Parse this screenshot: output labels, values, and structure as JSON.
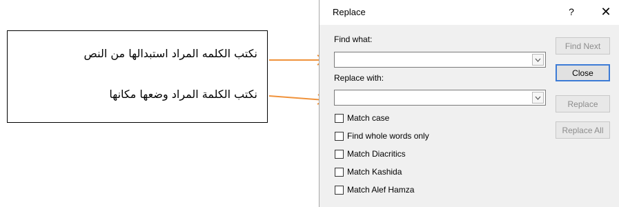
{
  "annotations": {
    "note1": "نكتب الكلمه المراد استبدالها من النص",
    "note2": "نكتب الكلمة المراد وضعها مكانها"
  },
  "dialog": {
    "title": "Replace",
    "help_label": "?",
    "close_label": "✕",
    "find_label": "Find what:",
    "find_value": "",
    "replace_label": "Replace with:",
    "replace_value": "",
    "buttons": {
      "find_next": "Find Next",
      "close": "Close",
      "replace": "Replace",
      "replace_all": "Replace All"
    },
    "options": [
      {
        "label": "Match case",
        "checked": false
      },
      {
        "label": "Find whole words only",
        "checked": false
      },
      {
        "label": "Match Diacritics",
        "checked": false
      },
      {
        "label": "Match Kashida",
        "checked": false
      },
      {
        "label": "Match Alef Hamza",
        "checked": false
      }
    ]
  },
  "colors": {
    "arrow": "#f0923a",
    "default_button_border": "#3c7bd6"
  }
}
